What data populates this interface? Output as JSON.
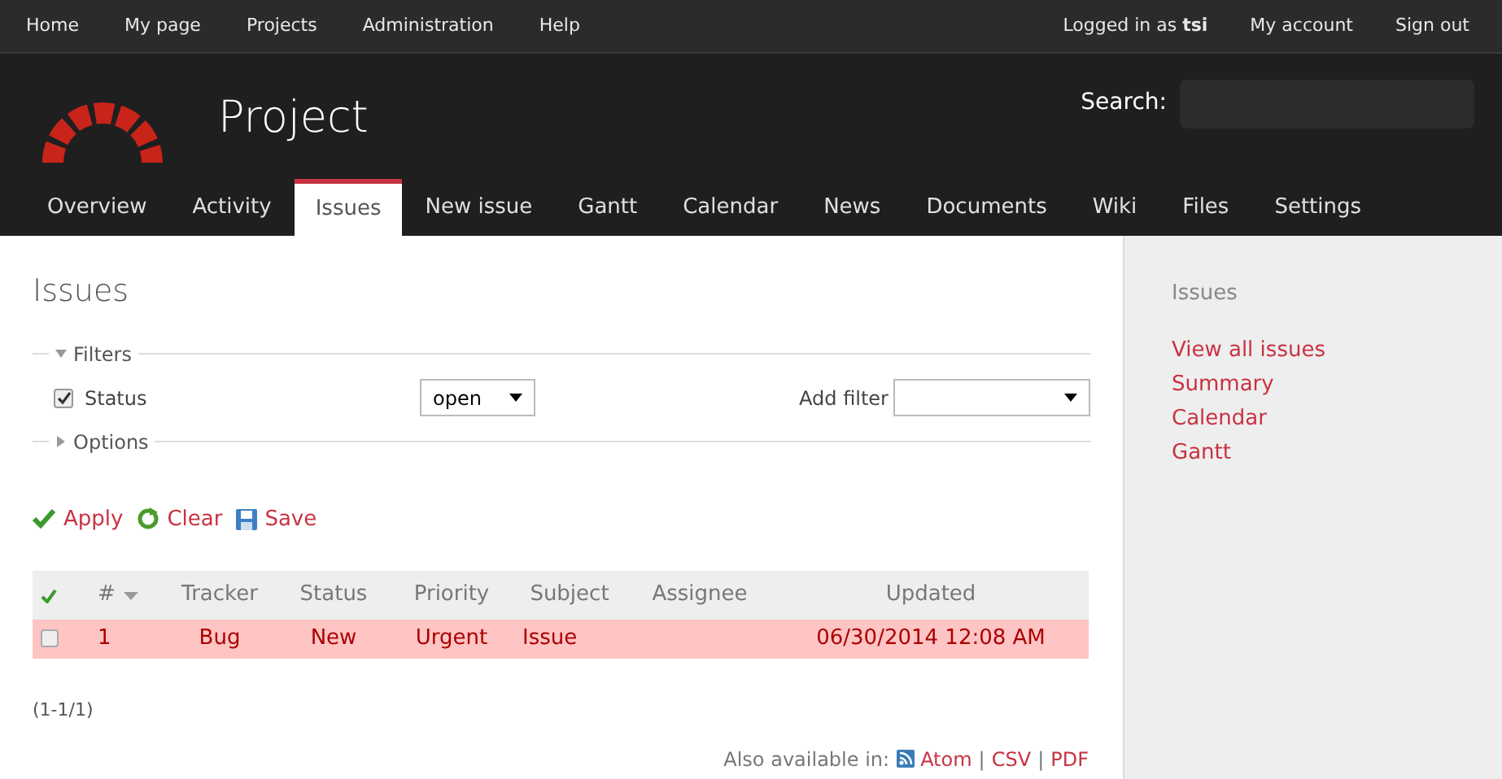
{
  "top_menu": [
    {
      "label": "Home"
    },
    {
      "label": "My page"
    },
    {
      "label": "Projects"
    },
    {
      "label": "Administration"
    },
    {
      "label": "Help"
    }
  ],
  "account": {
    "logged_in": "Logged in as **tsi**",
    "links": [
      {
        "label": "My account"
      },
      {
        "label": "Sign out"
      }
    ]
  },
  "header": {
    "project": "Project",
    "search_label": "Search:"
  },
  "main_menu": [
    {
      "label": "Overview",
      "selected": false
    },
    {
      "label": "Activity",
      "selected": false
    },
    {
      "label": "Issues",
      "selected": true
    },
    {
      "label": "New issue",
      "selected": false
    },
    {
      "label": "Gantt",
      "selected": false
    },
    {
      "label": "Calendar",
      "selected": false
    },
    {
      "label": "News",
      "selected": false
    },
    {
      "label": "Documents",
      "selected": false
    },
    {
      "label": "Wiki",
      "selected": false
    },
    {
      "label": "Files",
      "selected": false
    },
    {
      "label": "Settings",
      "selected": false
    }
  ],
  "content": {
    "title": "Issues",
    "filters": {
      "legend": "Filters",
      "expanded": true,
      "rows": [
        {
          "checked": true,
          "label": "Status",
          "operator": "open"
        }
      ],
      "add_filter": "Add filter"
    },
    "options": {
      "legend": "Options",
      "expanded": false
    },
    "actions": [
      {
        "kind": "apply",
        "label": "Apply"
      },
      {
        "kind": "clear",
        "label": "Clear"
      },
      {
        "kind": "save",
        "label": "Save"
      }
    ],
    "table": {
      "columns": [
        "#",
        "Tracker",
        "Status",
        "Priority",
        "Subject",
        "Assignee",
        "Updated"
      ],
      "rows": [
        {
          "checked": false,
          "cells": [
            "1",
            "Bug",
            "New",
            "Urgent",
            "Issue",
            "",
            "06/30/2014 12:08 AM"
          ]
        }
      ]
    },
    "pagination": "(1-1/1)",
    "also_available": {
      "label": "Also available in:",
      "separator": "|",
      "formats": [
        {
          "kind": "feed",
          "label": "Atom"
        },
        {
          "kind": "plain",
          "label": "CSV"
        },
        {
          "kind": "plain",
          "label": "PDF"
        }
      ]
    }
  },
  "sidebar": {
    "title": "Issues",
    "links": [
      {
        "label": "View all issues"
      },
      {
        "label": "Summary"
      },
      {
        "label": "Calendar"
      },
      {
        "label": "Gantt"
      }
    ]
  }
}
